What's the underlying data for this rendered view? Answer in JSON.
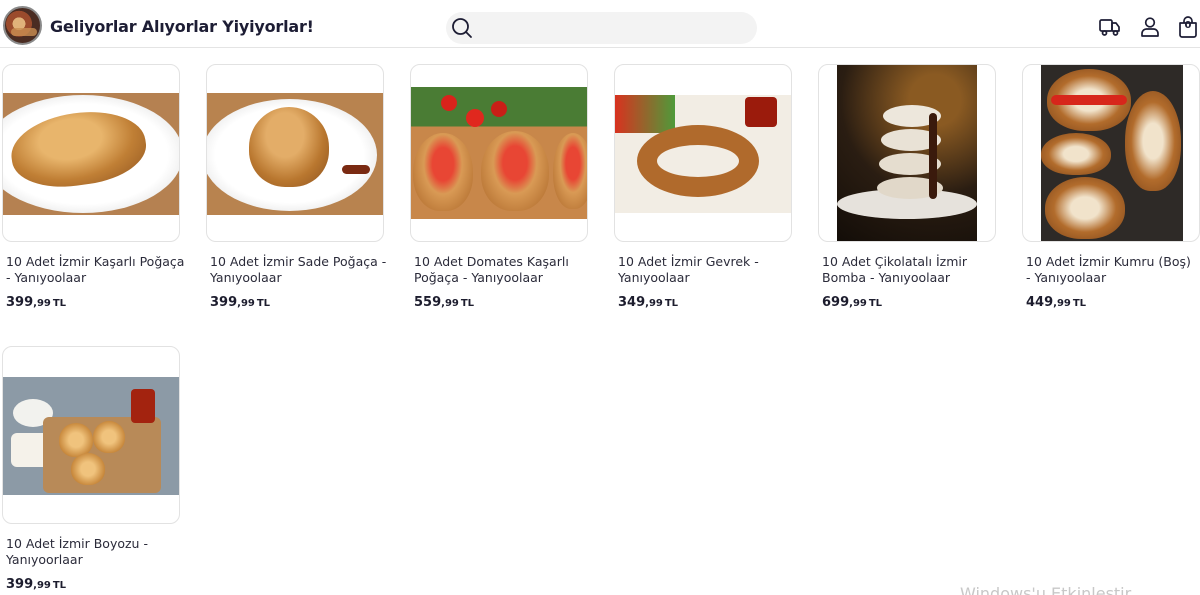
{
  "header": {
    "site_title": "Geliyorlar Alıyorlar Yiyiyorlar!",
    "search_placeholder": "",
    "cart_count": "0",
    "icons": [
      "logo",
      "search-icon",
      "truck-icon",
      "user-icon",
      "shopping-bag-icon"
    ]
  },
  "products": [
    {
      "name": "10 Adet İzmir Kaşarlı Poğaça - Yanıyoolaar",
      "price_main": "399",
      "price_dec": ",99",
      "currency": "TL"
    },
    {
      "name": "10 Adet İzmir Sade Poğaça - Yanıyoolaar",
      "price_main": "399",
      "price_dec": ",99",
      "currency": "TL"
    },
    {
      "name": "10 Adet Domates Kaşarlı Poğaça - Yanıyoolaar",
      "price_main": "559",
      "price_dec": ",99",
      "currency": "TL"
    },
    {
      "name": "10 Adet İzmir Gevrek - Yanıyoolaar",
      "price_main": "349",
      "price_dec": ",99",
      "currency": "TL"
    },
    {
      "name": "10 Adet Çikolatalı İzmir Bomba - Yanıyoolaar",
      "price_main": "699",
      "price_dec": ",99",
      "currency": "TL"
    },
    {
      "name": "10 Adet İzmir Kumru (Boş) - Yanıyoolaar",
      "price_main": "449",
      "price_dec": ",99",
      "currency": "TL"
    },
    {
      "name": "10 Adet İzmir Boyozu - Yanıyoorlaar",
      "price_main": "399",
      "price_dec": ",99",
      "currency": "TL"
    }
  ],
  "watermark": "Windows'u Etkinleştir"
}
